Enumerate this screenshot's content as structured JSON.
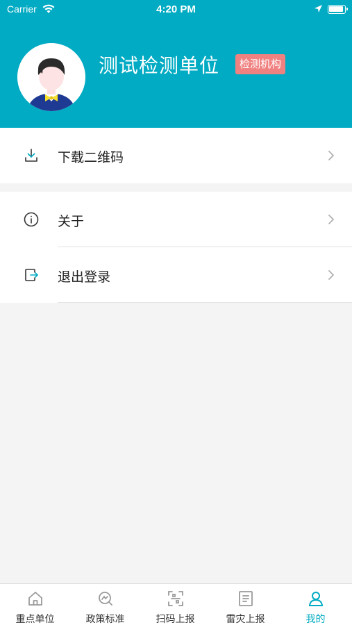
{
  "status_bar": {
    "carrier": "Carrier",
    "time": "4:20 PM"
  },
  "profile": {
    "name": "测试检测单位",
    "badge": "检测机构"
  },
  "menu": {
    "download_qr": "下载二维码",
    "about": "关于",
    "logout": "退出登录"
  },
  "tabs": [
    {
      "label": "重点单位",
      "icon": "home-icon"
    },
    {
      "label": "政策标准",
      "icon": "policy-icon"
    },
    {
      "label": "扫码上报",
      "icon": "scan-icon"
    },
    {
      "label": "雷灾上报",
      "icon": "report-icon"
    },
    {
      "label": "我的",
      "icon": "user-icon",
      "active": true
    }
  ],
  "colors": {
    "accent": "#00abc3",
    "badge": "#f08181",
    "background": "#f4f4f4"
  }
}
